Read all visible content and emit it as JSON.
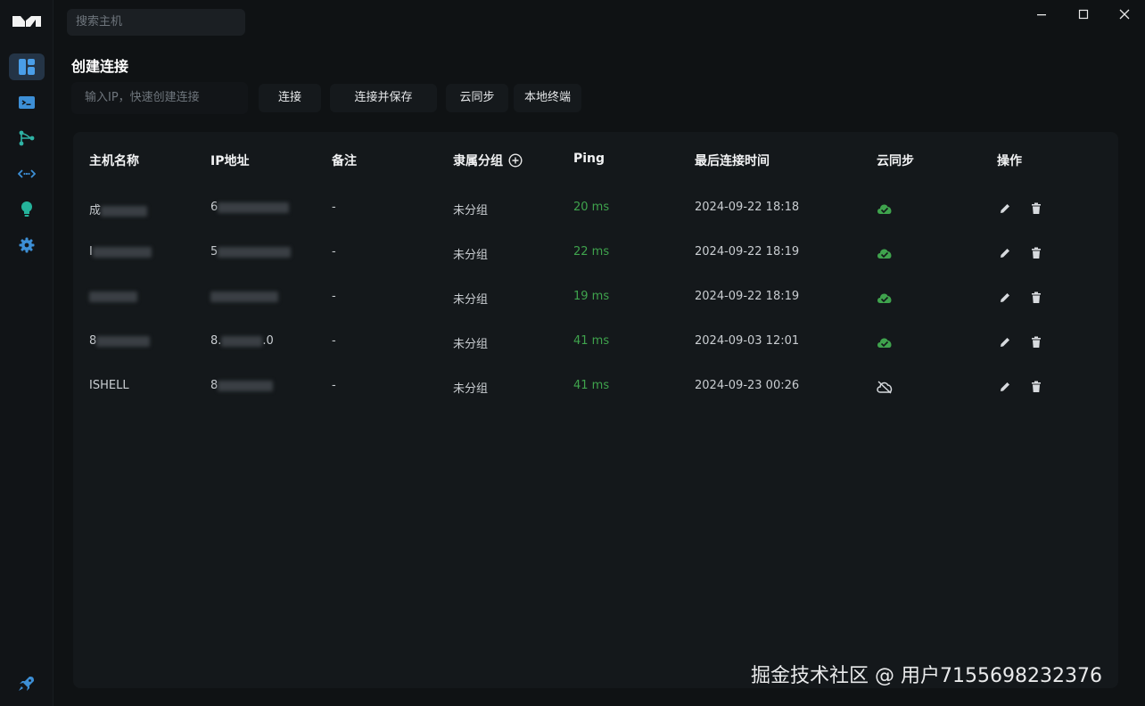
{
  "search": {
    "placeholder": "搜索主机"
  },
  "main": {
    "title": "创建连接",
    "ip_placeholder": "输入IP，快速创建连接",
    "buttons": {
      "connect": "连接",
      "connect_save": "连接并保存",
      "cloud_sync": "云同步",
      "local_terminal": "本地终端"
    }
  },
  "table": {
    "headers": {
      "name": "主机名称",
      "ip": "IP地址",
      "note": "备注",
      "group": "隶属分组",
      "ping": "Ping",
      "last": "最后连接时间",
      "sync": "云同步",
      "ops": "操作"
    },
    "rows": [
      {
        "name": "成",
        "ip": "6",
        "note": "-",
        "group": "未分组",
        "ping": "20 ms",
        "last": "2024-09-22 18:18",
        "synced": true
      },
      {
        "name": "I",
        "ip": "5",
        "note": "-",
        "group": "未分组",
        "ping": "22 ms",
        "last": "2024-09-22 18:19",
        "synced": true
      },
      {
        "name": "",
        "ip": "",
        "note": "-",
        "group": "未分组",
        "ping": "19 ms",
        "last": "2024-09-22 18:19",
        "synced": true
      },
      {
        "name": "8",
        "ip": "8.",
        "ip_tail": ".0",
        "note": "-",
        "group": "未分组",
        "ping": "41 ms",
        "last": "2024-09-03 12:01",
        "synced": true
      },
      {
        "name": "ISHELL",
        "ip": "8",
        "note": "-",
        "group": "未分组",
        "ping": "41 ms",
        "last": "2024-09-23 00:26",
        "synced": false
      }
    ]
  },
  "colors": {
    "accent": "#4a9ee8",
    "ping_green": "#3fa34d",
    "sync_green": "#3fa34d"
  },
  "watermark": "掘金技术社区 @ 用户7155698232376"
}
